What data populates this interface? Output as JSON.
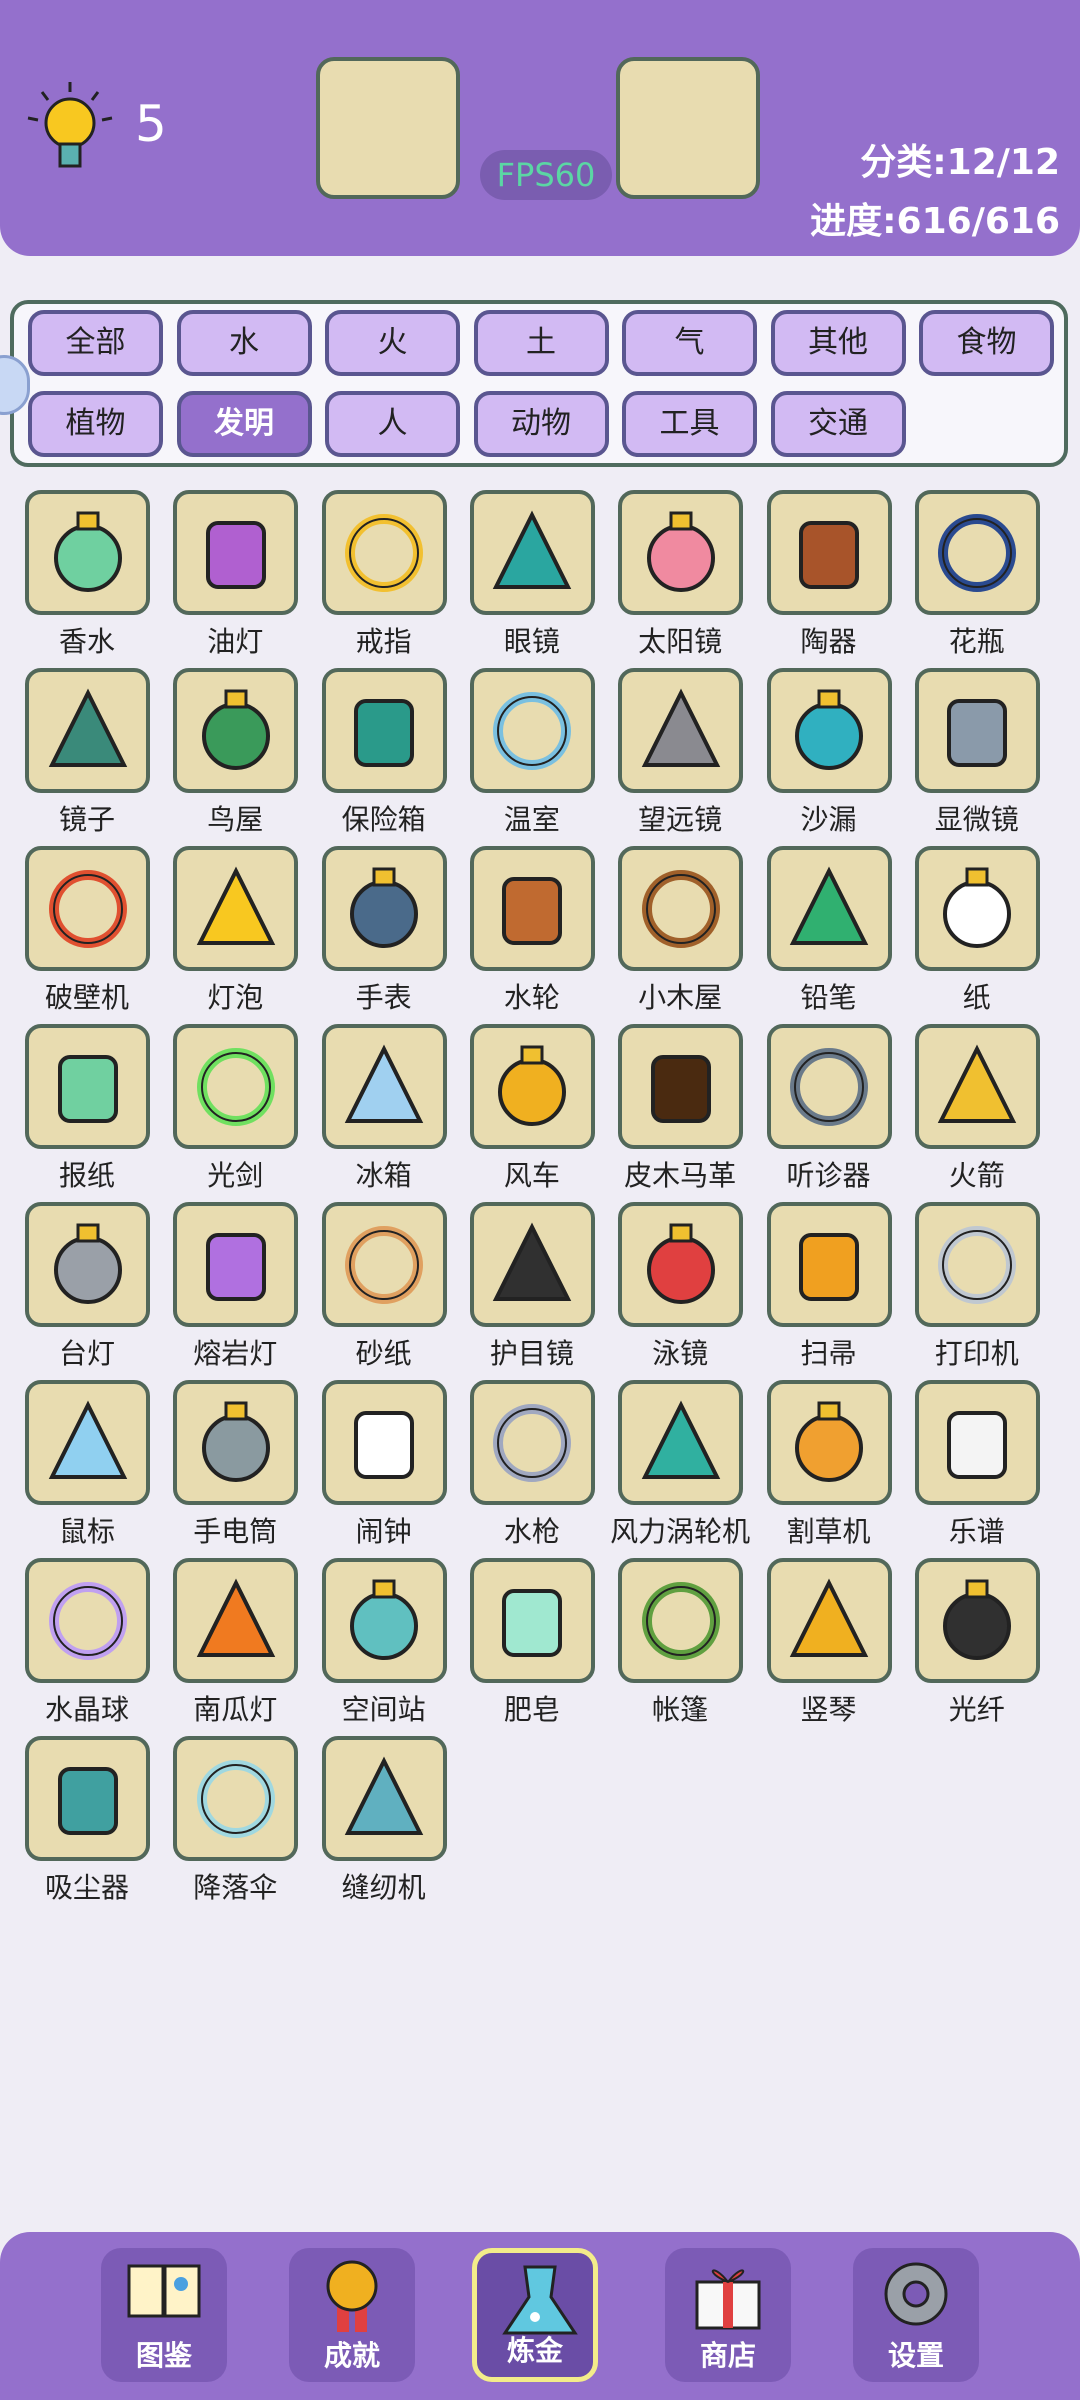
{
  "header": {
    "hint_count": "5",
    "fps": "FPS60",
    "category_stat": "分类:12/12",
    "progress_stat": "进度:616/616"
  },
  "categories": [
    "全部",
    "水",
    "火",
    "土",
    "气",
    "其他",
    "食物",
    "植物",
    "发明",
    "人",
    "动物",
    "工具",
    "交通"
  ],
  "active_category": "发明",
  "items": [
    {
      "label": "香水",
      "icon": "perfume-icon",
      "color": "#6fd0a0"
    },
    {
      "label": "油灯",
      "icon": "oil-lamp-icon",
      "color": "#b060d0"
    },
    {
      "label": "戒指",
      "icon": "ring-icon",
      "color": "#f2c030"
    },
    {
      "label": "眼镜",
      "icon": "glasses-icon",
      "color": "#2aa6a0"
    },
    {
      "label": "太阳镜",
      "icon": "sunglasses-icon",
      "color": "#f08aa0"
    },
    {
      "label": "陶器",
      "icon": "pottery-icon",
      "color": "#a8542a"
    },
    {
      "label": "花瓶",
      "icon": "vase-icon",
      "color": "#2a4a90"
    },
    {
      "label": "镜子",
      "icon": "mirror-icon",
      "color": "#3a8a7a"
    },
    {
      "label": "鸟屋",
      "icon": "birdhouse-icon",
      "color": "#3a9a5a"
    },
    {
      "label": "保险箱",
      "icon": "safe-icon",
      "color": "#2a9a8a"
    },
    {
      "label": "温室",
      "icon": "greenhouse-icon",
      "color": "#7ac0e0"
    },
    {
      "label": "望远镜",
      "icon": "telescope-icon",
      "color": "#8a8a90"
    },
    {
      "label": "沙漏",
      "icon": "hourglass-icon",
      "color": "#30b0c0"
    },
    {
      "label": "显微镜",
      "icon": "microscope-icon",
      "color": "#8a9aaa"
    },
    {
      "label": "破壁机",
      "icon": "blender-icon",
      "color": "#e05030"
    },
    {
      "label": "灯泡",
      "icon": "light-bulb-icon",
      "color": "#f8c820"
    },
    {
      "label": "手表",
      "icon": "watch-icon",
      "color": "#4a6a8a"
    },
    {
      "label": "水轮",
      "icon": "water-wheel-icon",
      "color": "#c06a30"
    },
    {
      "label": "小木屋",
      "icon": "cabin-icon",
      "color": "#a0602a"
    },
    {
      "label": "铅笔",
      "icon": "pencil-icon",
      "color": "#30b070"
    },
    {
      "label": "纸",
      "icon": "paper-icon",
      "color": "#ffffff"
    },
    {
      "label": "报纸",
      "icon": "newspaper-icon",
      "color": "#70d0a0"
    },
    {
      "label": "光剑",
      "icon": "lightsaber-icon",
      "color": "#70e060"
    },
    {
      "label": "冰箱",
      "icon": "fridge-icon",
      "color": "#a0d0f0"
    },
    {
      "label": "风车",
      "icon": "windmill-icon",
      "color": "#f0b020"
    },
    {
      "label": "皮木马革",
      "icon": "leather-icon",
      "color": "#4a2a10"
    },
    {
      "label": "听诊器",
      "icon": "stethoscope-icon",
      "color": "#6a7a8a"
    },
    {
      "label": "火箭",
      "icon": "rocket-icon",
      "color": "#f0c030"
    },
    {
      "label": "台灯",
      "icon": "desk-lamp-icon",
      "color": "#9aa0a8"
    },
    {
      "label": "熔岩灯",
      "icon": "lava-lamp-icon",
      "color": "#b070e0"
    },
    {
      "label": "砂纸",
      "icon": "sandpaper-icon",
      "color": "#e0a060"
    },
    {
      "label": "护目镜",
      "icon": "goggles-icon",
      "color": "#303030"
    },
    {
      "label": "泳镜",
      "icon": "swim-goggles-icon",
      "color": "#e04040"
    },
    {
      "label": "扫帚",
      "icon": "broom-icon",
      "color": "#f0a020"
    },
    {
      "label": "打印机",
      "icon": "printer-icon",
      "color": "#c0c8d0"
    },
    {
      "label": "鼠标",
      "icon": "mouse-icon",
      "color": "#90d0f0"
    },
    {
      "label": "手电筒",
      "icon": "flashlight-icon",
      "color": "#8a9aa0"
    },
    {
      "label": "闹钟",
      "icon": "alarm-clock-icon",
      "color": "#ffffff"
    },
    {
      "label": "水枪",
      "icon": "water-gun-icon",
      "color": "#a0a8c0"
    },
    {
      "label": "风力涡轮机",
      "icon": "wind-turbine-icon",
      "color": "#30b0a0"
    },
    {
      "label": "割草机",
      "icon": "lawn-mower-icon",
      "color": "#f0a030"
    },
    {
      "label": "乐谱",
      "icon": "sheet-music-icon",
      "color": "#f4f4f4"
    },
    {
      "label": "水晶球",
      "icon": "crystal-ball-icon",
      "color": "#c0a0f0"
    },
    {
      "label": "南瓜灯",
      "icon": "jack-o-lantern-icon",
      "color": "#f07a20"
    },
    {
      "label": "空间站",
      "icon": "space-station-icon",
      "color": "#60c0c0"
    },
    {
      "label": "肥皂",
      "icon": "soap-icon",
      "color": "#a0e8d0"
    },
    {
      "label": "帐篷",
      "icon": "tent-icon",
      "color": "#60a040"
    },
    {
      "label": "竖琴",
      "icon": "harp-icon",
      "color": "#f0b020"
    },
    {
      "label": "光纤",
      "icon": "fiber-optic-icon",
      "color": "#303030"
    },
    {
      "label": "吸尘器",
      "icon": "vacuum-icon",
      "color": "#40a0a0"
    },
    {
      "label": "降落伞",
      "icon": "parachute-icon",
      "color": "#a0d8e0"
    },
    {
      "label": "缝纫机",
      "icon": "sewing-machine-icon",
      "color": "#60b0c0"
    }
  ],
  "nav": [
    {
      "label": "图鉴",
      "icon": "book-icon"
    },
    {
      "label": "成就",
      "icon": "medal-icon"
    },
    {
      "label": "炼金",
      "icon": "flask-icon"
    },
    {
      "label": "商店",
      "icon": "gift-icon"
    },
    {
      "label": "设置",
      "icon": "gear-icon"
    }
  ],
  "active_nav": "炼金"
}
